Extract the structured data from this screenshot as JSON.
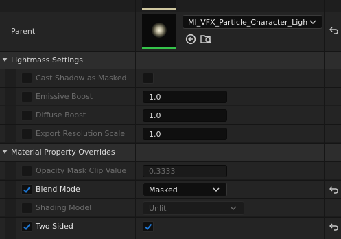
{
  "parent": {
    "label": "Parent",
    "asset_name": "MI_VFX_Particle_Character_Lightr",
    "icons": [
      "browse-to-asset-icon",
      "find-in-content-browser-icon"
    ]
  },
  "lightmass": {
    "title": "Lightmass Settings",
    "items": [
      {
        "label": "Cast Shadow as Masked",
        "checked": false,
        "value_type": "checkbox"
      },
      {
        "label": "Emissive Boost",
        "checked": false,
        "value": "1.0"
      },
      {
        "label": "Diffuse Boost",
        "checked": false,
        "value": "1.0"
      },
      {
        "label": "Export Resolution Scale",
        "checked": false,
        "value": "1.0"
      }
    ]
  },
  "overrides": {
    "title": "Material Property Overrides",
    "opacity": {
      "label": "Opacity Mask Clip Value",
      "value": "0.3333",
      "checked": false
    },
    "blend": {
      "label": "Blend Mode",
      "value": "Masked",
      "checked": true
    },
    "shading": {
      "label": "Shading Model",
      "value": "Unlit",
      "checked": false
    },
    "twosided": {
      "label": "Two Sided",
      "checked": true,
      "value_checked": true
    }
  },
  "colors": {
    "accent": "#1e78d6",
    "green_bar": "#35c44a"
  }
}
